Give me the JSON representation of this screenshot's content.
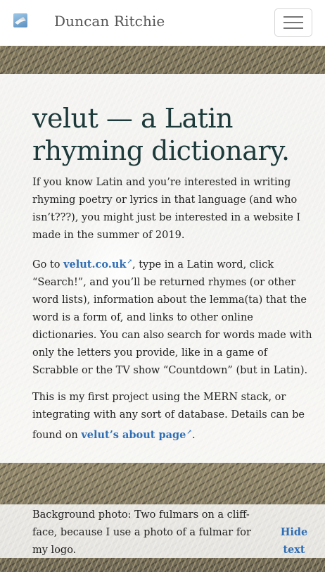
{
  "navbar": {
    "brand": "Duncan Ritchie",
    "logo_icon": "fulmar-logo-icon",
    "menu_icon": "hamburger-menu-icon"
  },
  "main": {
    "title": "velut — a Latin rhyming dictionary.",
    "p1": "If you know Latin and you’re interested in writing rhyming poetry or lyrics in that language (and who isn’t???), you might just be interested in a website I made in the summer of 2019.",
    "p2_before": "Go to ",
    "p2_link": "velut.co.uk",
    "p2_after": ", type in a Latin word, click “Search!”, and you’ll be returned rhymes (or other word lists), information about the lemma(ta) that the word is a form of, and links to other online dictionaries. You can also search for words made with only the letters you provide, like in a game of Scrabble or the TV show “Countdown” (but in Latin).",
    "p3_before": "This is my first project using the MERN stack, or integrating with any sort of database. Details can be found on ",
    "p3_link": "velut’s about page",
    "p3_after": ".",
    "external_link_icon": "↗"
  },
  "caption": {
    "text": "Background photo: Two fulmars on a cliff-face, because I use a photo of a fulmar for my logo.",
    "hide_label": "Hide text"
  },
  "colors": {
    "link": "#2f6eb5",
    "heading": "#1d3a3a"
  }
}
